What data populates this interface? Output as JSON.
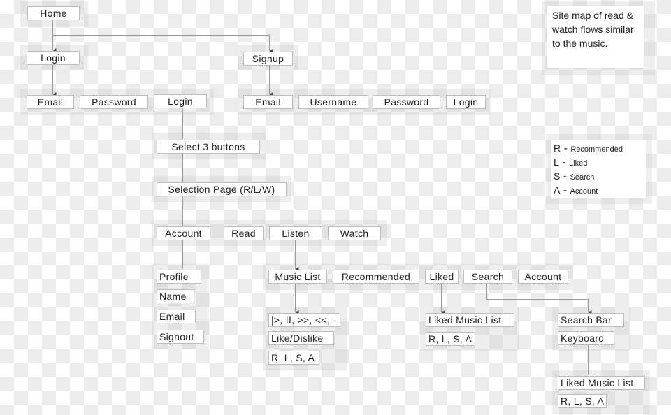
{
  "nodes": {
    "home": "Home",
    "login": "Login",
    "signup": "Signup",
    "login_email": "Email",
    "login_password": "Password",
    "login_button": "Login",
    "signup_email": "Email",
    "signup_username": "Username",
    "signup_password": "Password",
    "signup_login": "Login",
    "select_buttons": "Select 3 buttons",
    "selection_page": "Selection Page (R/L/W)",
    "account": "Account",
    "read": "Read",
    "listen": "Listen",
    "watch": "Watch",
    "profile": "Profile",
    "name": "Name",
    "email": "Email",
    "signout": "Signout",
    "music_list": "Music List",
    "recommended": "Recommended",
    "liked": "Liked",
    "search": "Search",
    "account2": "Account",
    "controls": "|>, II, >>, <<, -",
    "like_dislike": "Like/Dislike",
    "rlsa1": "R, L, S, A",
    "liked_music_list": "Liked Music List",
    "rlsa2": "R, L, S, A",
    "search_bar": "Search Bar",
    "keyboard": "Keyboard",
    "liked_music_list2": "Liked Music List",
    "rlsa3": "R, L, S, A"
  },
  "note": "Site map of read & watch flows similar to the music.",
  "legend": [
    {
      "key": "R",
      "label": "Recommended"
    },
    {
      "key": "L",
      "label": "Liked"
    },
    {
      "key": "S",
      "label": "Search"
    },
    {
      "key": "A",
      "label": "Account"
    }
  ]
}
